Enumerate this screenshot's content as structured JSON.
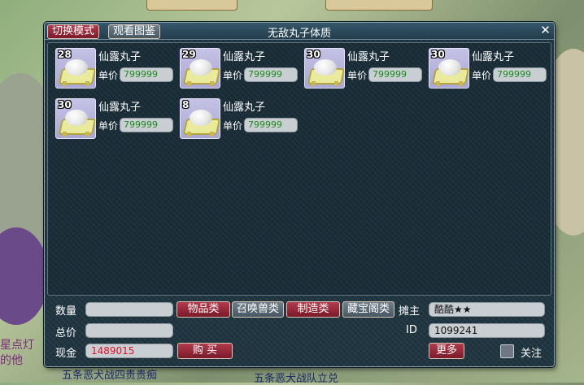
{
  "background": {
    "top_left_sign": "",
    "bottom_text_left": "五条恶犬战四贵贵痴",
    "bottom_text_right": "五条恶犬战队立兑",
    "left_text_1": "星点灯",
    "left_text_2": "的他"
  },
  "window": {
    "title": "无敌丸子体质",
    "tab_switch_mode": "切换模式",
    "tab_view_catalog": "观看图鉴",
    "close_glyph": "✕"
  },
  "items": [
    {
      "count": "28",
      "name": "仙露丸子",
      "price_label": "单价",
      "price": "799999",
      "icon": "dumpling-on-plate-icon"
    },
    {
      "count": "29",
      "name": "仙露丸子",
      "price_label": "单价",
      "price": "799999",
      "icon": "dumpling-on-plate-icon"
    },
    {
      "count": "30",
      "name": "仙露丸子",
      "price_label": "单价",
      "price": "799999",
      "icon": "dumpling-on-plate-icon"
    },
    {
      "count": "30",
      "name": "仙露丸子",
      "price_label": "单价",
      "price": "799999",
      "icon": "dumpling-on-plate-icon"
    },
    {
      "count": "30",
      "name": "仙露丸子",
      "price_label": "单价",
      "price": "799999",
      "icon": "dumpling-on-plate-icon"
    },
    {
      "count": "8",
      "name": "仙露丸子",
      "price_label": "单价",
      "price": "799999",
      "icon": "dumpling-on-plate-icon"
    }
  ],
  "form": {
    "quantity_label": "数量",
    "quantity_value": "",
    "total_label": "总价",
    "total_value": "",
    "cash_label": "现金",
    "cash_value": "1489015",
    "buy_button": "购 买",
    "cat_items": "物品类",
    "cat_summon": "召唤兽类",
    "cat_craft": "制造类",
    "cat_treasure": "藏宝阁类",
    "stall_owner_label": "摊主",
    "stall_owner_value": "酷酷★★",
    "id_label": "ID",
    "id_value": "1099241",
    "more_button": "更多",
    "follow_label": "关注"
  },
  "colors": {
    "accent_red": "#b23a4d",
    "price_green": "#1b8a1b",
    "cash_red": "#e0102a",
    "panel_bg": "#1f3540"
  }
}
